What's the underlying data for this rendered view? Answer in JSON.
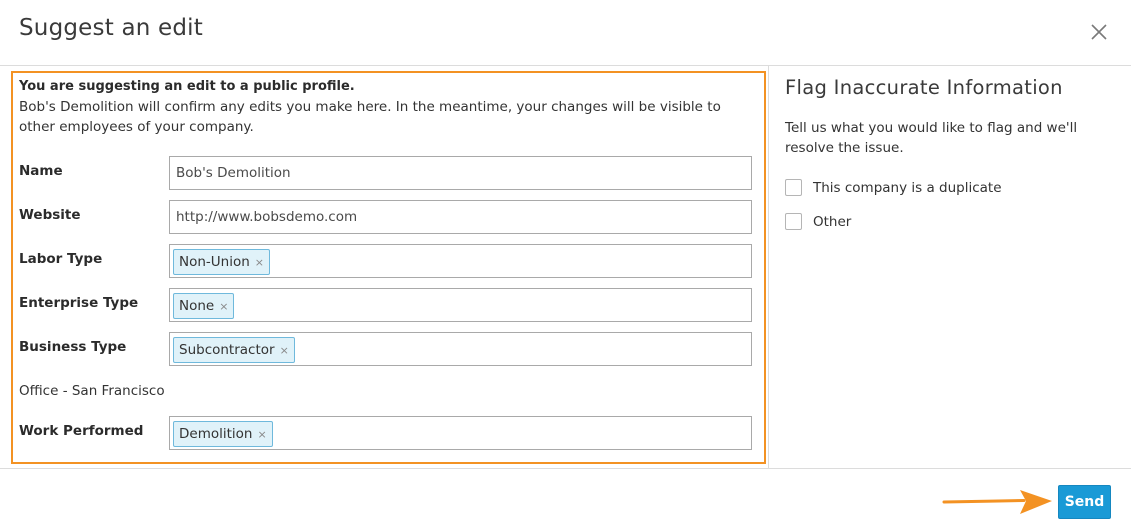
{
  "dialog": {
    "title": "Suggest an edit"
  },
  "intro": {
    "title": "You are suggesting an edit to a public profile.",
    "text": "Bob's Demolition will confirm any edits you make here. In the meantime, your changes will be visible to other employees of your company."
  },
  "form": {
    "name": {
      "label": "Name",
      "value": "Bob's Demolition"
    },
    "website": {
      "label": "Website",
      "value": "http://www.bobsdemo.com"
    },
    "labor_type": {
      "label": "Labor Type",
      "tags": [
        "Non-Union"
      ]
    },
    "enterprise_type": {
      "label": "Enterprise Type",
      "tags": [
        "None"
      ]
    },
    "business_type": {
      "label": "Business Type",
      "tags": [
        "Subcontractor"
      ]
    },
    "office": {
      "label": "Office - San Francisco"
    },
    "work_performed": {
      "label": "Work Performed",
      "tags": [
        "Demolition"
      ]
    },
    "tag_remove_glyph": "×"
  },
  "flag": {
    "title": "Flag Inaccurate Information",
    "description": "Tell us what you would like to flag and we'll resolve the issue.",
    "options": [
      {
        "label": "This company is a duplicate",
        "checked": false
      },
      {
        "label": "Other",
        "checked": false
      }
    ]
  },
  "footer": {
    "send_label": "Send"
  },
  "colors": {
    "highlight_border": "#f39223",
    "arrow": "#f39223",
    "send_button": "#1a9ad6",
    "tag_bg": "#e0f2f9",
    "tag_border": "#6fb9dc"
  },
  "icons": {
    "close": "close-icon",
    "annotation_arrow": "arrow-right-icon"
  }
}
